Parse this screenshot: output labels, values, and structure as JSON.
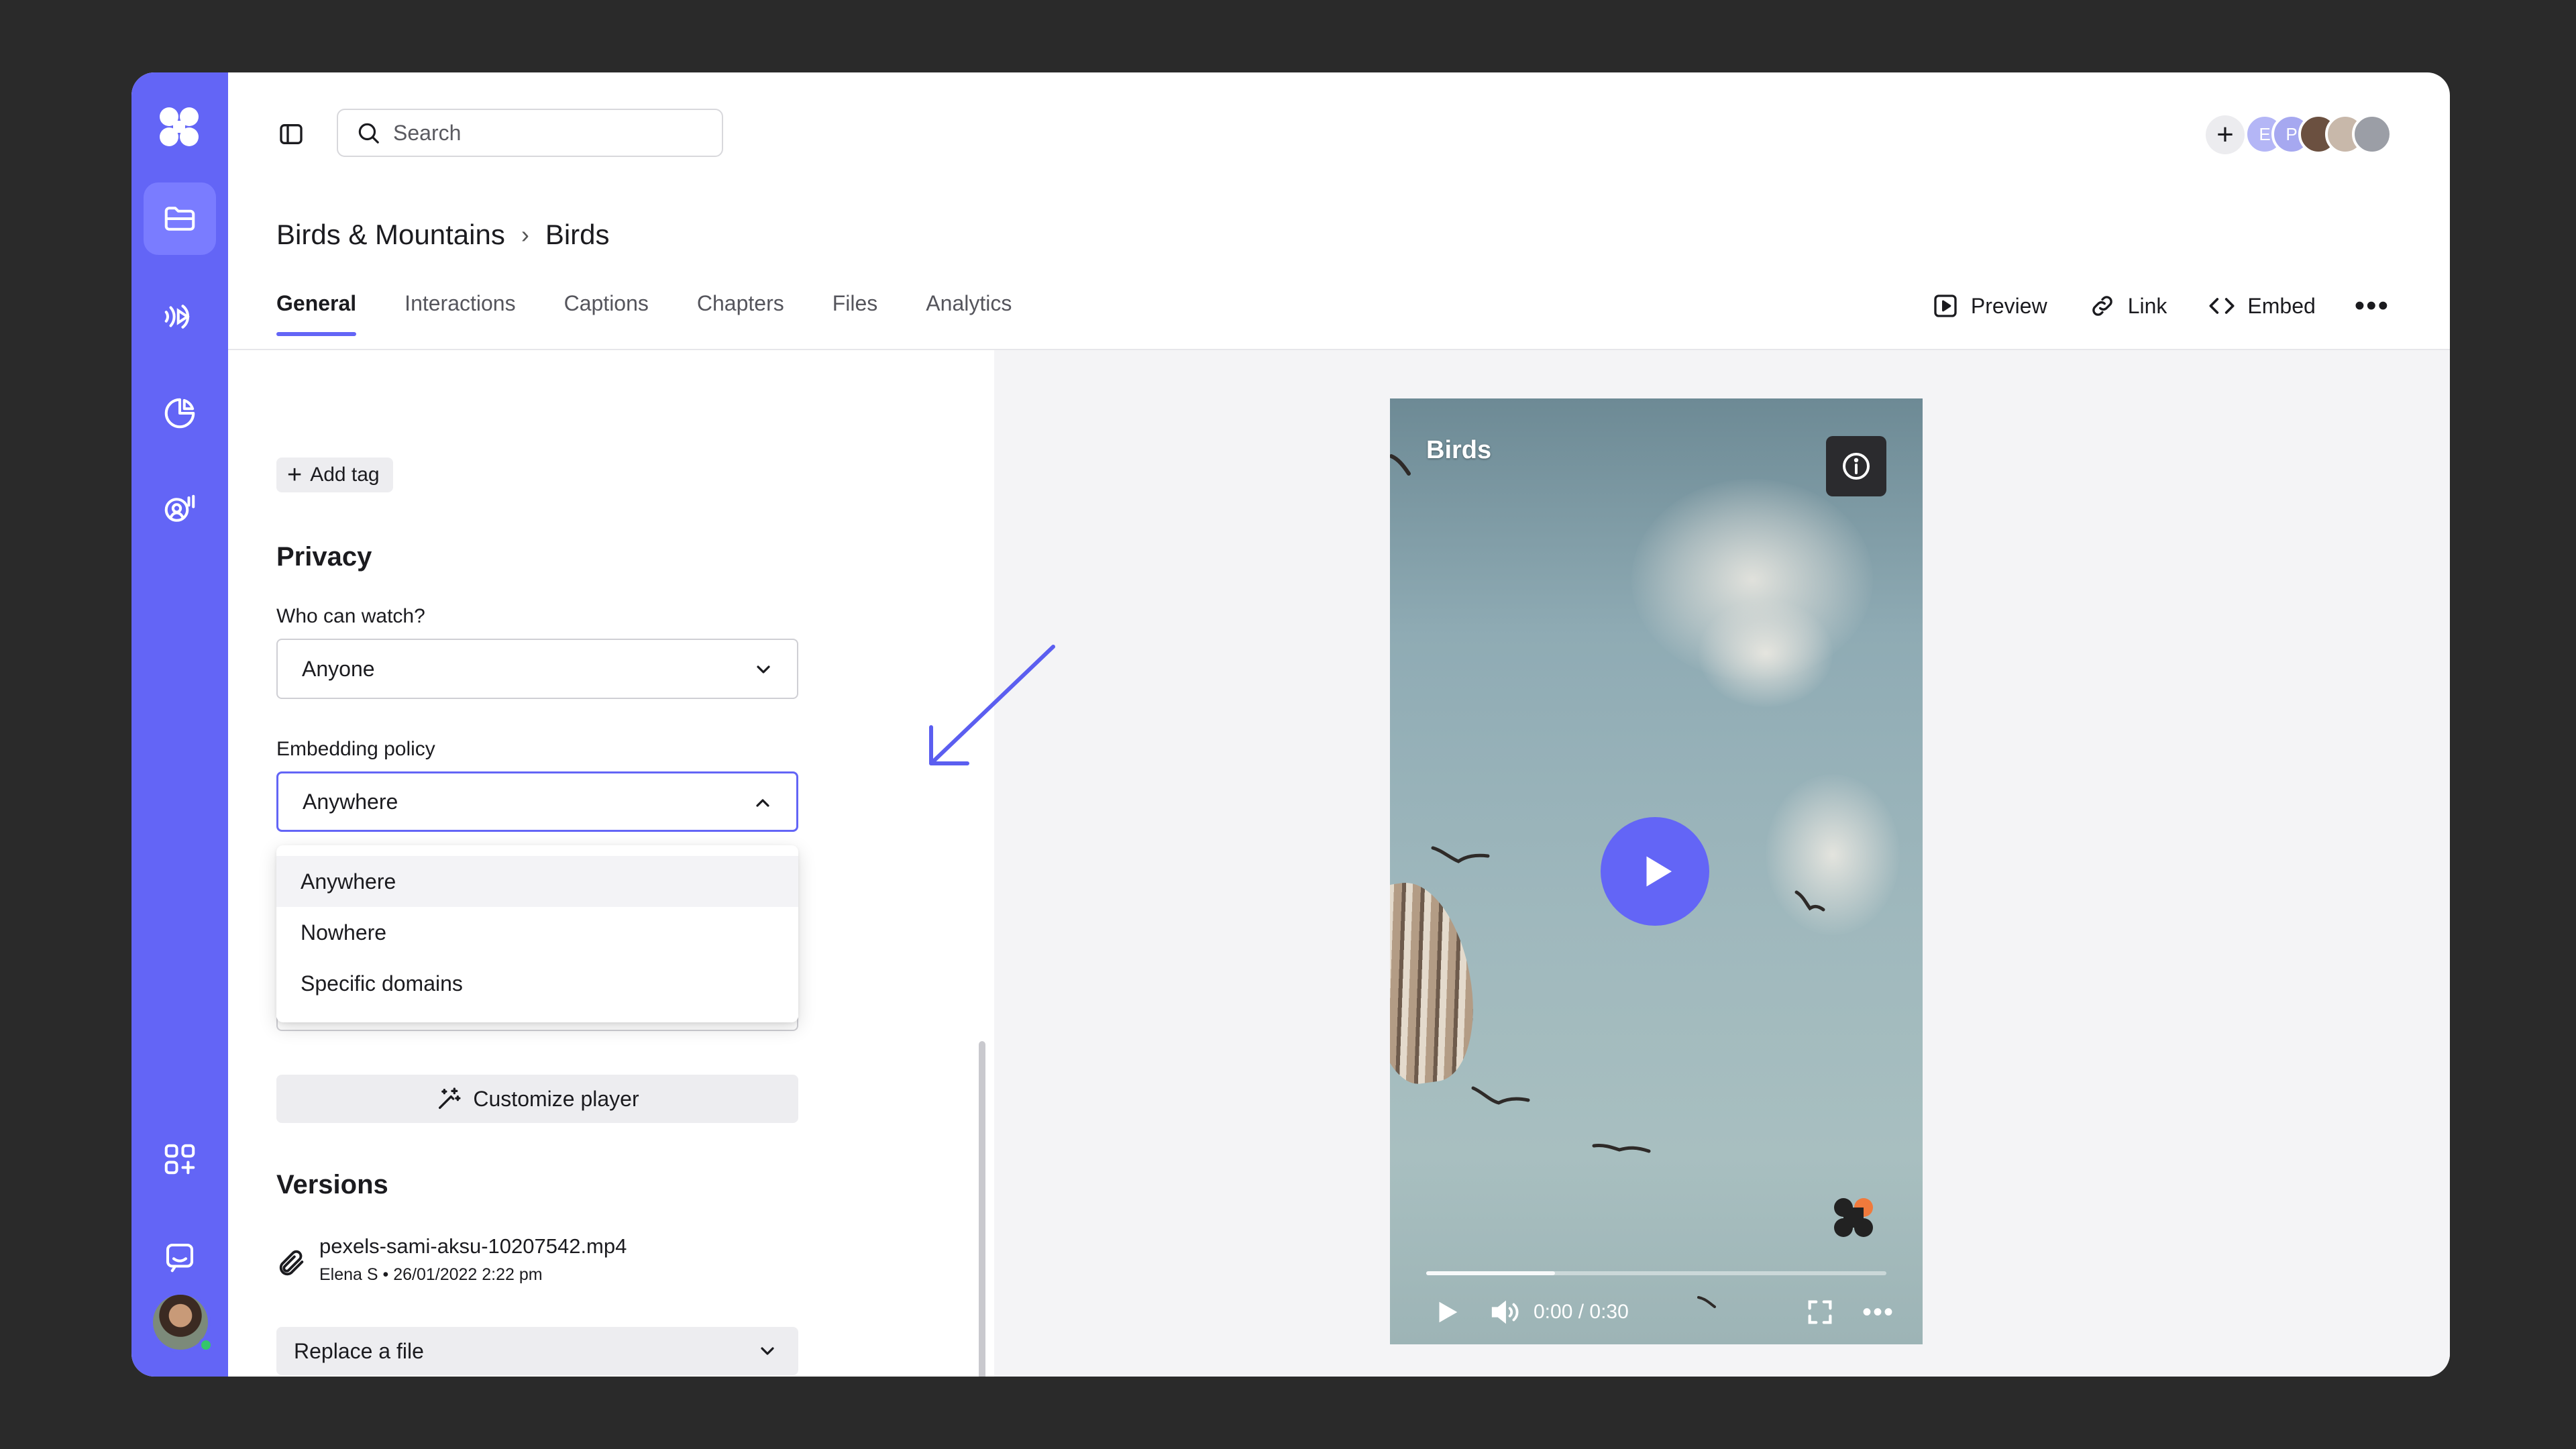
{
  "search": {
    "placeholder": "Search"
  },
  "header": {
    "members": [
      {
        "initial": "E",
        "color": "#b4b6f6"
      },
      {
        "initial": "P",
        "color": "#a6a8f0"
      },
      {
        "initial": "",
        "color": "#6b5040"
      },
      {
        "initial": "",
        "color": "#c8b8aa"
      },
      {
        "initial": "",
        "color": "#9b9ea6"
      }
    ]
  },
  "breadcrumb": {
    "parent": "Birds & Mountains",
    "separator": "›",
    "current": "Birds"
  },
  "tabs": [
    "General",
    "Interactions",
    "Captions",
    "Chapters",
    "Files",
    "Analytics"
  ],
  "active_tab": "General",
  "actions": {
    "preview": "Preview",
    "link": "Link",
    "embed": "Embed",
    "more": "•••"
  },
  "tags": {
    "add_label": "Add tag"
  },
  "privacy": {
    "title": "Privacy",
    "who_label": "Who can watch?",
    "who_value": "Anyone",
    "embed_label": "Embedding policy",
    "embed_value": "Anywhere",
    "embed_options": [
      "Anywhere",
      "Nowhere",
      "Specific domains"
    ],
    "customize_label": "Customize player"
  },
  "versions": {
    "title": "Versions",
    "file_name": "pexels-sami-aksu-10207542.mp4",
    "file_meta": "Elena S • 26/01/2022 2:22 pm",
    "replace_label": "Replace a file"
  },
  "video": {
    "title": "Birds",
    "time": "0:00 / 0:30",
    "progress_fraction": 0.28
  },
  "colors": {
    "accent": "#6365f6",
    "rail": "#6365f6",
    "brand_orange": "#f07a3c",
    "brand_dark": "#222222"
  }
}
